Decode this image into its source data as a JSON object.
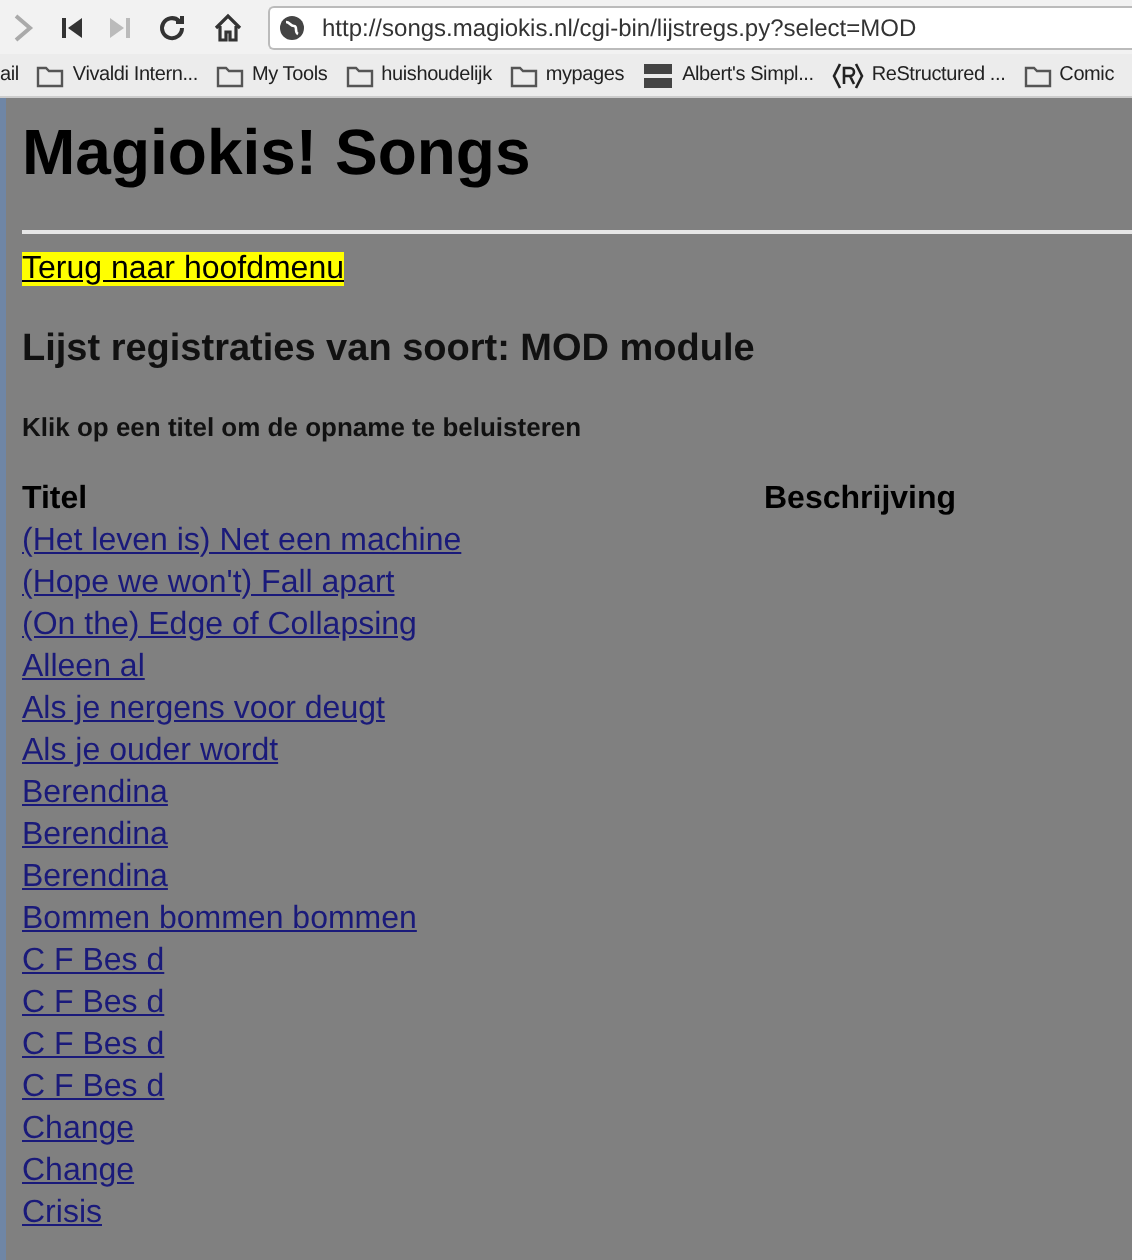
{
  "toolbar": {
    "url": "http://songs.magiokis.nl/cgi-bin/lijstregs.py?select=MOD"
  },
  "bookmarks": [
    {
      "label": "ail",
      "kind": "cut"
    },
    {
      "label": "Vivaldi Intern...",
      "kind": "folder"
    },
    {
      "label": "My Tools",
      "kind": "folder"
    },
    {
      "label": "huishoudelijk",
      "kind": "folder"
    },
    {
      "label": "mypages",
      "kind": "folder"
    },
    {
      "label": "Albert's Simpl...",
      "kind": "logo"
    },
    {
      "label": "ReStructured ...",
      "kind": "r"
    },
    {
      "label": "Comic",
      "kind": "folder"
    }
  ],
  "page": {
    "title": "Magiokis! Songs",
    "back_link": "Terug naar hoofdmenu",
    "heading": "Lijst registraties van soort: MOD module",
    "instruction": "Klik op een titel om de opname te beluisteren",
    "table": {
      "columns": [
        "Titel",
        "Beschrijving"
      ],
      "rows": [
        "(Het leven is) Net een machine",
        "(Hope we won't) Fall apart",
        "(On the) Edge of Collapsing",
        "Alleen al",
        "Als je nergens voor deugt",
        "Als je ouder wordt",
        "Berendina",
        "Berendina",
        "Berendina",
        "Bommen bommen bommen",
        "C F Bes d",
        "C F Bes d",
        "C F Bes d",
        "C F Bes d",
        "Change",
        "Change",
        "Crisis"
      ]
    }
  }
}
